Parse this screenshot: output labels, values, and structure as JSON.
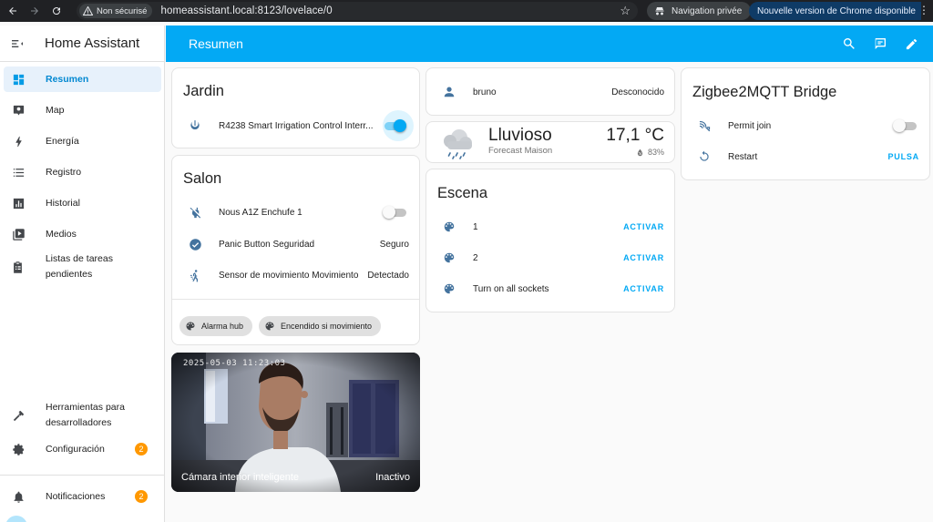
{
  "browser": {
    "security_label": "Non sécurisé",
    "url": "homeassistant.local:8123/lovelace/0",
    "private_label": "Navigation privée",
    "update_label": "Nouvelle version de Chrome disponible"
  },
  "sidebar": {
    "title": "Home Assistant",
    "items": [
      {
        "label": "Resumen",
        "icon": "dashboard-icon"
      },
      {
        "label": "Map",
        "icon": "map-icon"
      },
      {
        "label": "Energía",
        "icon": "lightning-icon"
      },
      {
        "label": "Registro",
        "icon": "list-icon"
      },
      {
        "label": "Historial",
        "icon": "chart-icon"
      },
      {
        "label": "Medios",
        "icon": "media-icon"
      },
      {
        "label": "Listas de tareas pendientes",
        "icon": "clipboard-icon"
      }
    ],
    "dev_tools_label": "Herramientas para desarrolladores",
    "settings_label": "Configuración",
    "settings_badge": "2",
    "notifications_label": "Notificaciones",
    "notifications_badge": "2"
  },
  "header": {
    "title": "Resumen",
    "accent": "#03a9f4"
  },
  "cards": {
    "jardin": {
      "title": "Jardin",
      "entity_name": "R4238 Smart Irrigation Control Interr...",
      "toggle_on": true
    },
    "salon": {
      "title": "Salon",
      "rows": [
        {
          "name": "Nous A1Z Enchufe 1",
          "value": ""
        },
        {
          "name": "Panic Button Seguridad",
          "value": "Seguro"
        },
        {
          "name": "Sensor de movimiento Movimiento",
          "value": "Detectado"
        }
      ],
      "chips": [
        "Alarma hub",
        "Encendido si movimiento"
      ]
    },
    "camera": {
      "timestamp": "2025-05-03  11:23:03",
      "name": "Cámara interior inteligente",
      "state": "Inactivo"
    },
    "person": {
      "name": "bruno",
      "state": "Desconocido"
    },
    "weather": {
      "condition": "Lluvioso",
      "location": "Forecast Maison",
      "temperature": "17,1 °C",
      "humidity": "83%"
    },
    "escena": {
      "title": "Escena",
      "rows": [
        {
          "name": "1",
          "action": "ACTIVAR"
        },
        {
          "name": "2",
          "action": "ACTIVAR"
        },
        {
          "name": "Turn on all sockets",
          "action": "ACTIVAR"
        }
      ]
    },
    "zigbee": {
      "title": "Zigbee2MQTT Bridge",
      "permit_join_label": "Permit join",
      "restart_label": "Restart",
      "restart_action": "PULSA"
    }
  }
}
